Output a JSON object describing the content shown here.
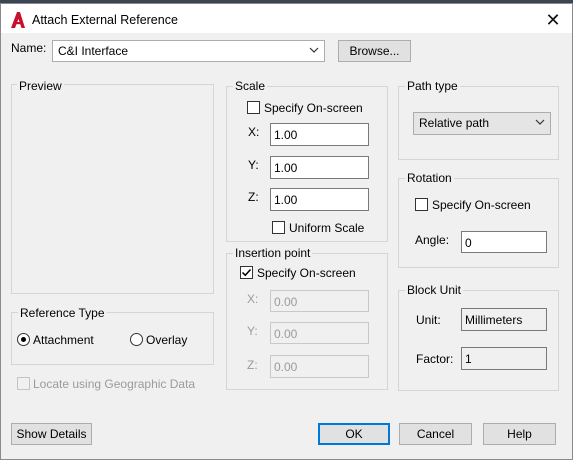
{
  "window": {
    "title": "Attach External Reference",
    "close": "✕"
  },
  "name_row": {
    "label": "Name:",
    "value": "C&I Interface",
    "browse": "Browse..."
  },
  "preview": {
    "title": "Preview"
  },
  "scale": {
    "title": "Scale",
    "specify_on_screen": "Specify On-screen",
    "x_label": "X:",
    "x_value": "1.00",
    "y_label": "Y:",
    "y_value": "1.00",
    "z_label": "Z:",
    "z_value": "1.00",
    "uniform": "Uniform Scale"
  },
  "insertion": {
    "title": "Insertion point",
    "specify_on_screen": "Specify On-screen",
    "x_label": "X:",
    "x_value": "0.00",
    "y_label": "Y:",
    "y_value": "0.00",
    "z_label": "Z:",
    "z_value": "0.00"
  },
  "path_type": {
    "title": "Path type",
    "value": "Relative path"
  },
  "rotation": {
    "title": "Rotation",
    "specify_on_screen": "Specify On-screen",
    "angle_label": "Angle:",
    "angle_value": "0"
  },
  "block_unit": {
    "title": "Block Unit",
    "unit_label": "Unit:",
    "unit_value": "Millimeters",
    "factor_label": "Factor:",
    "factor_value": "1"
  },
  "reference_type": {
    "title": "Reference Type",
    "attachment": "Attachment",
    "overlay": "Overlay"
  },
  "geo": {
    "label": "Locate using Geographic Data"
  },
  "buttons": {
    "show_details": "Show Details",
    "ok": "OK",
    "cancel": "Cancel",
    "help": "Help"
  },
  "colors": {
    "accent": "#0078d7",
    "app_icon": "#c8102e"
  }
}
